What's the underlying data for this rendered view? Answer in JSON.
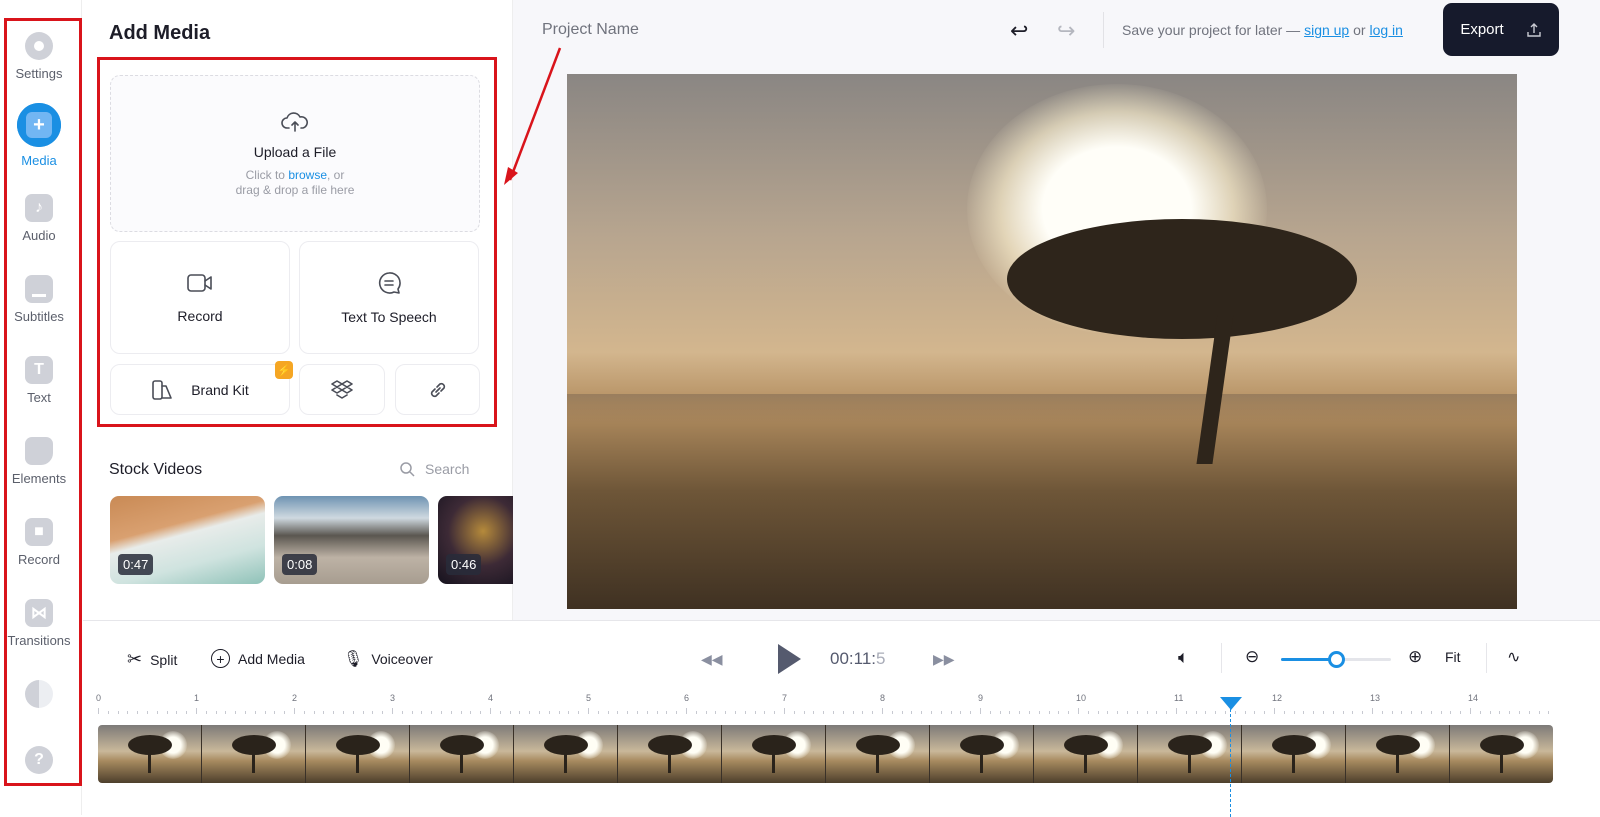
{
  "sidebar": {
    "items": [
      {
        "label": "Settings",
        "icon": "settings-icon"
      },
      {
        "label": "Media",
        "icon": "plus-icon",
        "active": true
      },
      {
        "label": "Audio",
        "icon": "music-note-icon"
      },
      {
        "label": "Subtitles",
        "icon": "subtitles-icon"
      },
      {
        "label": "Text",
        "icon": "text-icon"
      },
      {
        "label": "Elements",
        "icon": "sticker-icon"
      },
      {
        "label": "Record",
        "icon": "video-camera-icon"
      },
      {
        "label": "Transitions",
        "icon": "bowtie-icon"
      }
    ],
    "filters_icon": "contrast-icon",
    "help_icon": "help-icon"
  },
  "panel": {
    "title": "Add Media",
    "upload": {
      "title": "Upload a File",
      "hint_prefix": "Click to ",
      "browse": "browse",
      "hint_suffix": ", or",
      "hint_line2": "drag & drop a file here"
    },
    "record": "Record",
    "tts": "Text To Speech",
    "brand_kit": "Brand Kit",
    "badge_icon": "lightning-icon",
    "stock": {
      "title": "Stock Videos",
      "search_placeholder": "Search",
      "videos": [
        {
          "duration": "0:47"
        },
        {
          "duration": "0:08"
        },
        {
          "duration": "0:46"
        }
      ]
    }
  },
  "header": {
    "project_name": "Project Name",
    "save_text": "Save your project for later —",
    "sign_up": "sign up",
    "or": "or",
    "log_in": "log in",
    "export": "Export",
    "accent": "#1a8fe3",
    "export_bg": "#161a2c"
  },
  "timeline": {
    "split": "Split",
    "add_media": "Add Media",
    "voiceover": "Voiceover",
    "time": "00:11:",
    "time_frac": "5",
    "fit": "Fit",
    "zoom_level": 0.5,
    "ruler": [
      "0",
      "1",
      "2",
      "3",
      "4",
      "5",
      "6",
      "7",
      "8",
      "9",
      "10",
      "11",
      "12",
      "13",
      "14"
    ],
    "playhead_seconds": 11.55,
    "frame_count": 14
  },
  "annotation_color": "#d9141b"
}
